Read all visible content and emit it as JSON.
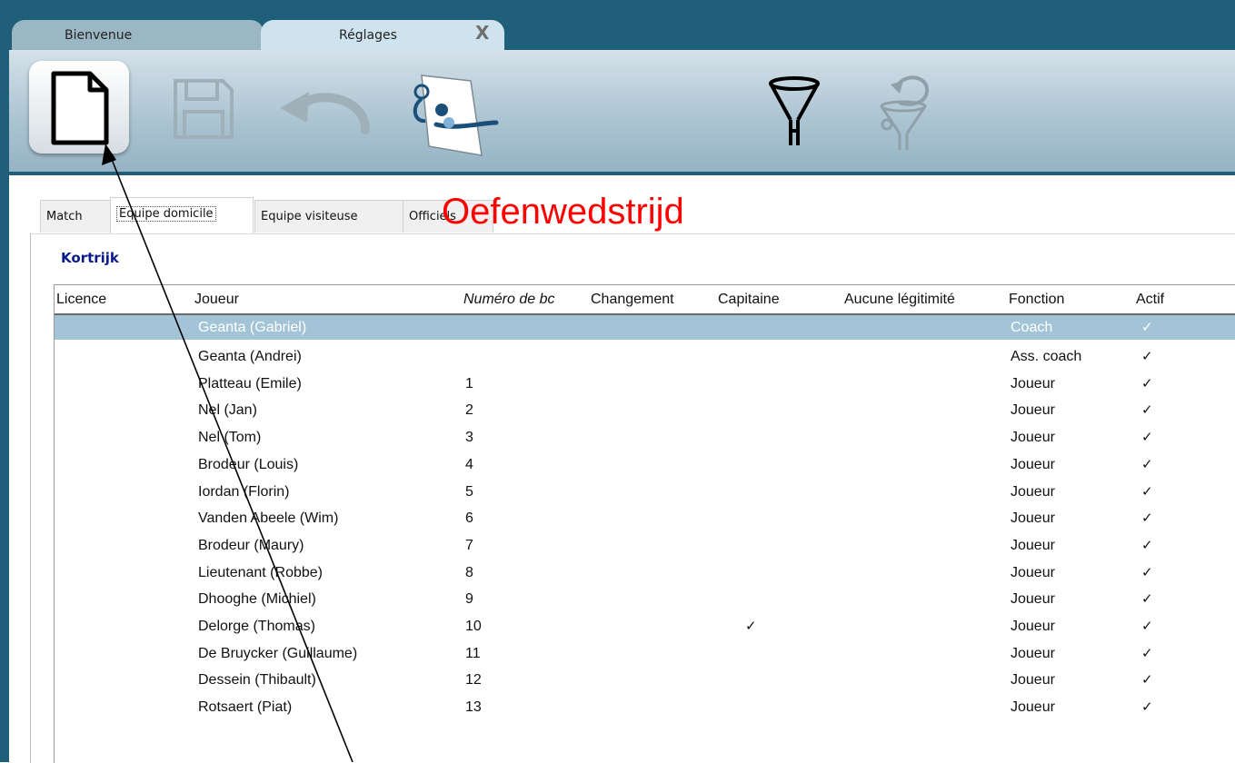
{
  "window": {
    "tabs": [
      {
        "label": "Bienvenue"
      },
      {
        "label": "Réglages",
        "close_glyph": "X"
      }
    ]
  },
  "toolbar": {
    "icons": [
      "new-document-icon",
      "save-icon",
      "undo-icon",
      "officials-icon",
      "filter-icon",
      "clear-filter-icon"
    ]
  },
  "subtabs": [
    "Match",
    "Equipe domicile",
    "Equipe visiteuse",
    "Officiels"
  ],
  "stamp": {
    "text": "Oefenwedstrijd",
    "color": "#ff0000"
  },
  "team": {
    "name": "Kortrijk"
  },
  "table": {
    "columns": [
      "Licence",
      "Joueur",
      "Numéro de bc",
      "Changement",
      "Capitaine",
      "Aucune légitimité",
      "Fonction",
      "Actif"
    ],
    "rows": [
      {
        "licence": "",
        "joueur": "Geanta (Gabriel)",
        "numero": "",
        "changement": "",
        "capitaine": "",
        "aucune": "",
        "fonction": "Coach",
        "actif": "✓"
      },
      {
        "licence": "",
        "joueur": "Geanta (Andrei)",
        "numero": "",
        "changement": "",
        "capitaine": "",
        "aucune": "",
        "fonction": "Ass. coach",
        "actif": "✓"
      },
      {
        "licence": "",
        "joueur": "Platteau (Emile)",
        "numero": "1",
        "changement": "",
        "capitaine": "",
        "aucune": "",
        "fonction": "Joueur",
        "actif": "✓"
      },
      {
        "licence": "",
        "joueur": "Nel (Jan)",
        "numero": "2",
        "changement": "",
        "capitaine": "",
        "aucune": "",
        "fonction": "Joueur",
        "actif": "✓"
      },
      {
        "licence": "",
        "joueur": "Nel (Tom)",
        "numero": "3",
        "changement": "",
        "capitaine": "",
        "aucune": "",
        "fonction": "Joueur",
        "actif": "✓"
      },
      {
        "licence": "",
        "joueur": "Brodeur (Louis)",
        "numero": "4",
        "changement": "",
        "capitaine": "",
        "aucune": "",
        "fonction": "Joueur",
        "actif": "✓"
      },
      {
        "licence": "",
        "joueur": "Iordan (Florin)",
        "numero": "5",
        "changement": "",
        "capitaine": "",
        "aucune": "",
        "fonction": "Joueur",
        "actif": "✓"
      },
      {
        "licence": "",
        "joueur": "Vanden Abeele (Wim)",
        "numero": "6",
        "changement": "",
        "capitaine": "",
        "aucune": "",
        "fonction": "Joueur",
        "actif": "✓"
      },
      {
        "licence": "",
        "joueur": "Brodeur (Maury)",
        "numero": "7",
        "changement": "",
        "capitaine": "",
        "aucune": "",
        "fonction": "Joueur",
        "actif": "✓"
      },
      {
        "licence": "",
        "joueur": "Lieutenant (Robbe)",
        "numero": "8",
        "changement": "",
        "capitaine": "",
        "aucune": "",
        "fonction": "Joueur",
        "actif": "✓"
      },
      {
        "licence": "",
        "joueur": "Dhooghe (Michiel)",
        "numero": "9",
        "changement": "",
        "capitaine": "",
        "aucune": "",
        "fonction": "Joueur",
        "actif": "✓"
      },
      {
        "licence": "",
        "joueur": "Delorge (Thomas)",
        "numero": "10",
        "changement": "",
        "capitaine": "✓",
        "aucune": "",
        "fonction": "Joueur",
        "actif": "✓"
      },
      {
        "licence": "",
        "joueur": "De Bruycker (Guillaume)",
        "numero": "11",
        "changement": "",
        "capitaine": "",
        "aucune": "",
        "fonction": "Joueur",
        "actif": "✓"
      },
      {
        "licence": "",
        "joueur": "Dessein (Thibault)",
        "numero": "12",
        "changement": "",
        "capitaine": "",
        "aucune": "",
        "fonction": "Joueur",
        "actif": "✓"
      },
      {
        "licence": "",
        "joueur": "Rotsaert (Piat)",
        "numero": "13",
        "changement": "",
        "capitaine": "",
        "aucune": "",
        "fonction": "Joueur",
        "actif": "✓"
      }
    ],
    "selected_row": 0
  },
  "colors": {
    "frame": "#1f5f7a",
    "selection": "#a3c4d6",
    "team_name": "#0a1a8a"
  }
}
